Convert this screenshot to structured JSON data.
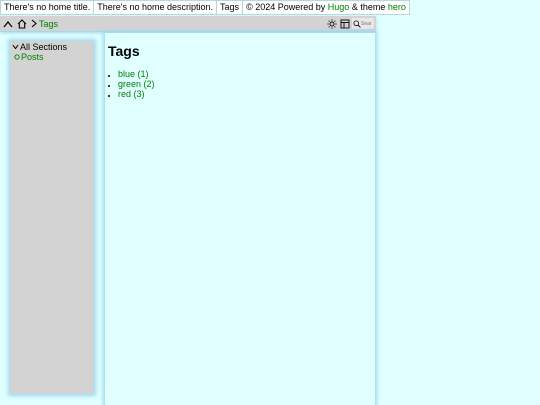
{
  "topbar": {
    "home_title": "There's no home title.",
    "home_description": "There's no home description.",
    "page": "Tags",
    "copyright": "© 2024",
    "powered_by": "Powered by",
    "hugo_link": "Hugo",
    "theme_text": "& theme",
    "theme_link": "hero"
  },
  "navbar": {
    "breadcrumb": "Tags",
    "search_placeholder": "Sear"
  },
  "sidebar": {
    "section_header": "All Sections",
    "items": [
      {
        "label": "Posts"
      }
    ]
  },
  "main": {
    "title": "Tags",
    "tags": [
      {
        "label": "blue (1)"
      },
      {
        "label": "green (2)"
      },
      {
        "label": "red (3)"
      }
    ]
  },
  "colors": {
    "link": "#008000",
    "page_bg": "#e0ffff",
    "panel_bg": "#d3d3d3",
    "shadow": "#9fd8f0"
  }
}
